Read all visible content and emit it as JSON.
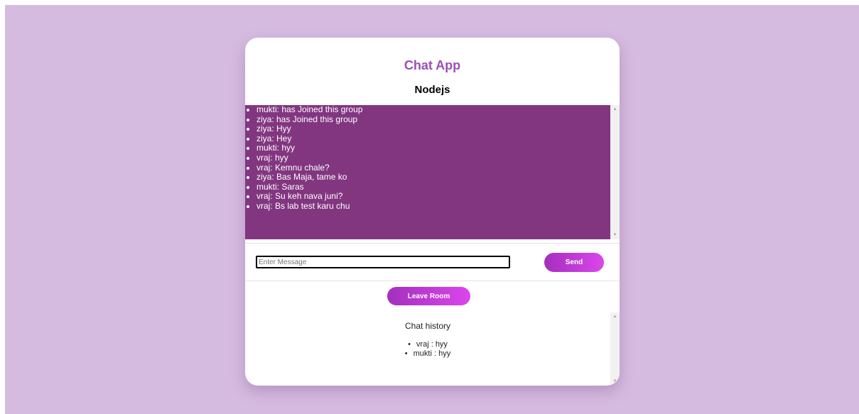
{
  "app": {
    "title": "Chat App",
    "room": "Nodejs"
  },
  "messages": [
    {
      "text": "mukti: has Joined this group"
    },
    {
      "text": "ziya: has Joined this group"
    },
    {
      "text": "ziya: Hyy"
    },
    {
      "text": "ziya: Hey"
    },
    {
      "text": "mukti: hyy"
    },
    {
      "text": "vraj: hyy"
    },
    {
      "text": "vraj: Kemnu chale?"
    },
    {
      "text": "ziya: Bas Maja, tame ko"
    },
    {
      "text": "mukti: Saras"
    },
    {
      "text": "vraj: Su keh nava juni?"
    },
    {
      "text": "vraj: Bs lab test karu chu"
    }
  ],
  "compose": {
    "value": "",
    "placeholder": "Enter Message",
    "send_label": "Send"
  },
  "leave_label": "Leave Room",
  "history": {
    "title": "Chat history",
    "items": [
      {
        "text": "vraj : hyy"
      },
      {
        "text": "mukti : hyy"
      }
    ]
  },
  "colors": {
    "page_background": "#d6bbe0",
    "accent_title": "#9b4fb5",
    "messages_background": "#823680",
    "button_gradient_start": "#a42fbd",
    "button_gradient_end": "#db46ec"
  },
  "icons": {
    "scroll_up": "scroll-up-arrow-icon",
    "scroll_down": "scroll-down-arrow-icon"
  }
}
